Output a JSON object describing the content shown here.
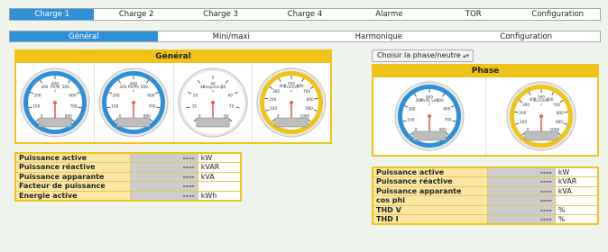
{
  "top_tabs": [
    {
      "label": "Charge 1",
      "active": true
    },
    {
      "label": "Charge 2",
      "active": false
    },
    {
      "label": "Charge 3",
      "active": false
    },
    {
      "label": "Charge 4",
      "active": false
    },
    {
      "label": "Alarme",
      "active": false
    },
    {
      "label": "TOR",
      "active": false
    },
    {
      "label": "Configuration",
      "active": false
    }
  ],
  "sub_tabs": [
    {
      "label": "Général",
      "active": true
    },
    {
      "label": "Mini/maxi",
      "active": false
    },
    {
      "label": "Harmonique",
      "active": false
    },
    {
      "label": "Configuration",
      "active": false
    }
  ],
  "general_panel": {
    "title": "Général",
    "gauges": [
      {
        "name": "Ph/N",
        "color": "#2f8fd7",
        "ticks": [
          "0",
          "100",
          "200",
          "300",
          "400",
          "500",
          "600",
          "700",
          "800"
        ]
      },
      {
        "name": "Ph/Ph",
        "color": "#2f8fd7",
        "ticks": [
          "0",
          "100",
          "200",
          "300",
          "400",
          "500",
          "600",
          "700",
          "800"
        ]
      },
      {
        "name": "Frequency",
        "color": "#ffffff",
        "ticks": [
          "0",
          "10",
          "20",
          "30",
          "40",
          "50",
          "60",
          "70",
          "80"
        ]
      },
      {
        "name": "Current",
        "color": "#f0c31a",
        "ticks": [
          "0",
          "100",
          "200",
          "300",
          "400",
          "500",
          "600",
          "700",
          "800",
          "900",
          "1000"
        ]
      }
    ]
  },
  "phase_select": {
    "value": "Choisir la phase/neutre"
  },
  "phase_panel": {
    "title": "Phase",
    "gauges": [
      {
        "name": "Ph/N_volt",
        "color": "#2f8fd7",
        "ticks": [
          "0",
          "100",
          "200",
          "300",
          "400",
          "500",
          "600",
          "700",
          "800"
        ]
      },
      {
        "name": "Current",
        "color": "#f0c31a",
        "ticks": [
          "0",
          "100",
          "200",
          "300",
          "400",
          "500",
          "600",
          "700",
          "800",
          "900",
          "1000"
        ]
      }
    ]
  },
  "general_measures": [
    {
      "label": "Puissance active",
      "value": "----",
      "unit": "kW"
    },
    {
      "label": "Puissance réactive",
      "value": "----",
      "unit": "kVAR"
    },
    {
      "label": "Puissance apparante",
      "value": "----",
      "unit": "kVA"
    },
    {
      "label": "Facteur de puissance",
      "value": "----",
      "unit": ""
    },
    {
      "label": "Energie active",
      "value": "----",
      "unit": "kWh"
    }
  ],
  "phase_measures": [
    {
      "label": "Puissance active",
      "value": "----",
      "unit": "kW"
    },
    {
      "label": "Puissance réactive",
      "value": "----",
      "unit": "kVAR"
    },
    {
      "label": "Puissance apparante",
      "value": "----",
      "unit": "kVA"
    },
    {
      "label": "cos phi",
      "value": "----",
      "unit": ""
    },
    {
      "label": "THD V",
      "value": "----",
      "unit": "%"
    },
    {
      "label": "THD I",
      "value": "----",
      "unit": "%"
    }
  ]
}
